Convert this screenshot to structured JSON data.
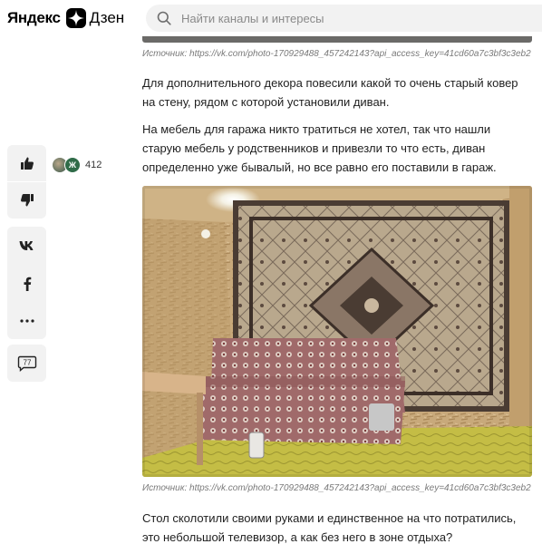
{
  "header": {
    "logo_yandex": "Яндекс",
    "logo_dzen": "Дзен",
    "search_placeholder": "Найти каналы и интересы"
  },
  "sidebar": {
    "like_icon": "thumbs-up-icon",
    "dislike_icon": "thumbs-down-icon",
    "share_vk_icon": "vk-icon",
    "share_fb_icon": "facebook-icon",
    "more_icon": "more-dots-icon",
    "comments_icon": "comment-icon",
    "comments_count": "77",
    "liker_avatar_letter": "Ж",
    "likes_count": "412"
  },
  "article": {
    "caption_top": "Источник: https://vk.com/photo-170929488_457242143?api_access_key=41cd60a7c3bf3c3eb2",
    "para1": "Для дополнительного декора повесили какой то очень старый ковер на стену, рядом с которой установили диван.",
    "para2": "На мебель для гаража никто тратиться не хотел, так что нашли старую мебель у родственников и привезли то что есть, диван определенно уже бывалый, но все равно его поставили в гараж.",
    "caption_bottom": "Источник: https://vk.com/photo-170929488_457242143?api_access_key=41cd60a7c3bf3c3eb2",
    "para3": "Стол сколотили своими руками и единственное на что потратились, это небольшой телевизор, а как без него в зоне отдыха?"
  },
  "colors": {
    "panel_bg": "#f2f2f2",
    "text": "#1f1f1f",
    "caption": "#7a7a7a",
    "avatar_green": "#2f6b48"
  }
}
